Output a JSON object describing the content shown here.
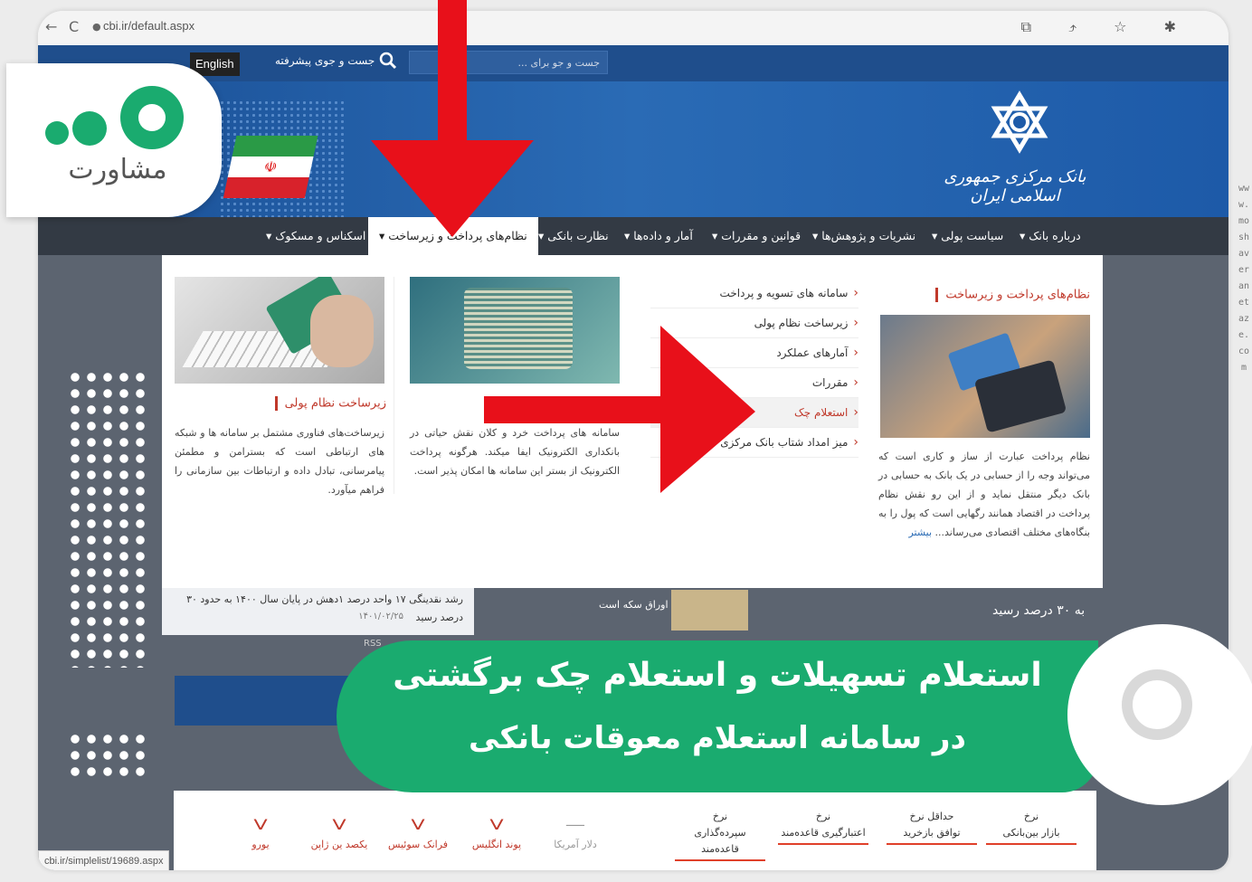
{
  "browser": {
    "url": "cbi.ir/default.aspx",
    "back_glyph": "←",
    "reload_glyph": "C",
    "lock_glyph": "🔒",
    "icons": "⧉ ⤴ ☆ ✱"
  },
  "header": {
    "english_label": "English",
    "advanced_search": "جست و جوی پیشرفته",
    "search_placeholder": "جست و جو برای ...",
    "bank_name": "بانک مرکزی جمهوری اسلامی ایران"
  },
  "menu": [
    {
      "label": "درباره بانک ▾"
    },
    {
      "label": "سیاست پولی ▾"
    },
    {
      "label": "نشریات و پژوهش‌ها ▾"
    },
    {
      "label": "قوانین و مقررات ▾"
    },
    {
      "label": "آمار و داده‌ها ▾"
    },
    {
      "label": "نظارت بانکی ▾"
    },
    {
      "label": "نظام‌های پرداخت و زیرساخت ▾"
    },
    {
      "label": "اسکناس و مسکوک ▾"
    }
  ],
  "panel": {
    "main_title": "نظام‌های پرداخت و زیرساخت",
    "main_text": "نظام پرداخت عبارت از ساز و کاری است که می‌تواند وجه را از حسابی در یک بانک به حسابی در بانک دیگر منتقل نماید و از این رو نقش نظام پرداخت در اقتصاد همانند رگهایی است که پول را به بنگاه‌های مختلف اقتصادی می‌رساند...",
    "more_link": "بیشتر",
    "list": [
      {
        "label": "سامانه های تسویه و پرداخت"
      },
      {
        "label": "زیرساخت نظام پولی"
      },
      {
        "label": "آمارهای عملکرد"
      },
      {
        "label": "مقررات"
      },
      {
        "label": "استعلام چک"
      },
      {
        "label": "میز امداد شتاب بانک مرکزی"
      }
    ],
    "card2_text": "سامانه های پرداخت خرد و کلان نقش حیاتی در بانکداری الکترونیک ایفا میکند. هرگونه پرداخت الکترونیک از بستر این سامانه ها امکان پذیر است.",
    "card3_title": "زیرساخت نظام پولی",
    "card3_text": "زیرساخت‌های فناوری مشتمل بر سامانه ها و شبکه های ارتباطی است که بسترامن و مطمئن پیامرسانی، تبادل داده و ارتباطات بین سازمانی را فراهم میآورد."
  },
  "news": {
    "right_text": "به ۳۰ درصد رسید",
    "left_line1": "رشد نقدینگی ۱۷ واحد درصد ۱دهش در پایان سال ۱۴۰۰ به حدود ۳۰",
    "left_line2": "درصد رسید",
    "left_date": "۱۴۰۱/۰۲/۲۵",
    "mid_text": "اوراق سکه است",
    "rss": "RSS"
  },
  "rates": [
    {
      "l1": "نرخ",
      "l2": "بازار بین‌بانکی"
    },
    {
      "l1": "حداقل نرخ",
      "l2": "توافق بازخرید"
    },
    {
      "l1": "نرخ",
      "l2": "اعتبارگیری قاعده‌مند"
    },
    {
      "l1": "نرخ",
      "l2": "سپرده‌گذاری قاعده‌مند"
    }
  ],
  "currencies": [
    {
      "label": "دلار آمریکا",
      "chev": "—"
    },
    {
      "label": "پوند انگلیس",
      "chev": "V"
    },
    {
      "label": "فرانک سوئیس",
      "chev": "V"
    },
    {
      "label": "یکصد ین ژاپن",
      "chev": "V"
    },
    {
      "label": "یورو",
      "chev": "V"
    }
  ],
  "status_url": "cbi.ir/simplelist/19689.aspx",
  "logo_text": "مشاورت",
  "banner": {
    "line1": "استعلام تسهیلات و استعلام چک برگشتی",
    "line2": "در سامانه استعلام معوقات بانکی"
  },
  "watermark": "www.moshaveranetaze.com",
  "colors": {
    "brand_blue": "#1f4e8c",
    "menu_dark": "#333a44",
    "accent_red": "#c0392b",
    "banner_green": "#1aab6f",
    "arrow_red": "#e8101a"
  }
}
